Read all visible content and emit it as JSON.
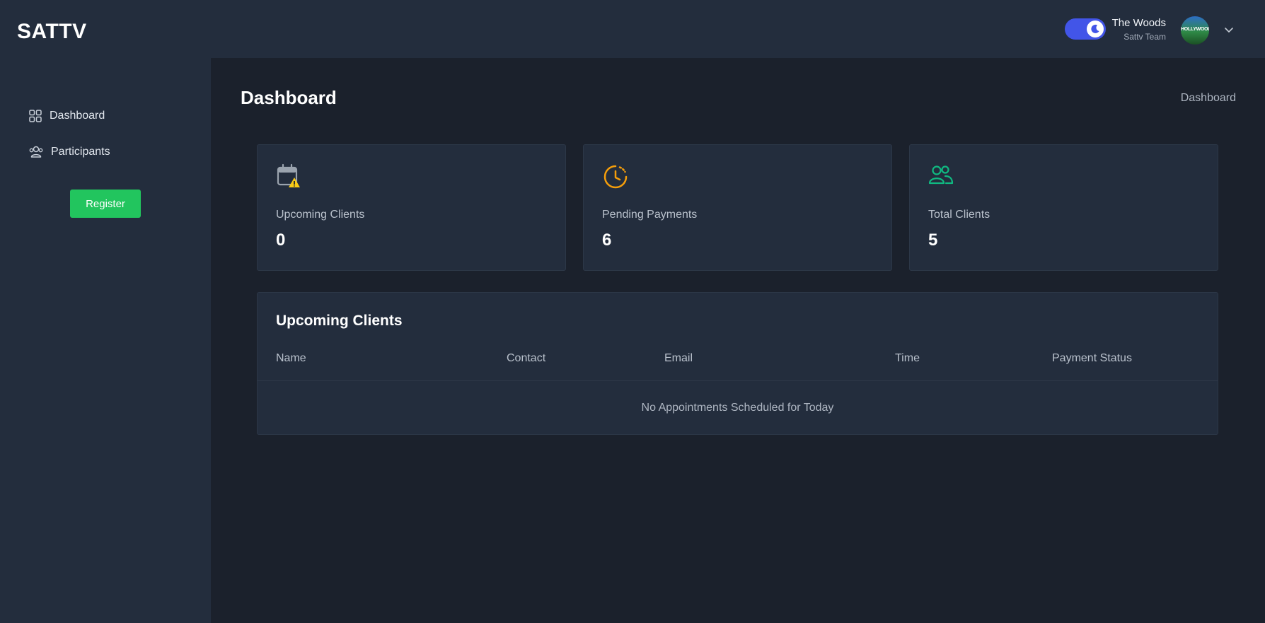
{
  "header": {
    "brand": "SATTV",
    "user": {
      "name": "The Woods",
      "team": "Sattv Team",
      "avatar_text": "HOLLYWOOD"
    },
    "theme_toggle_on": true,
    "accent": "#4255e8"
  },
  "sidebar": {
    "items": [
      {
        "label": "Dashboard",
        "icon": "grid-icon"
      },
      {
        "label": "Participants",
        "icon": "users-icon"
      }
    ],
    "register_label": "Register",
    "register_color": "#22c55e"
  },
  "main": {
    "title": "Dashboard",
    "breadcrumb": "Dashboard",
    "stats": [
      {
        "label": "Upcoming Clients",
        "value": "0",
        "icon": "calendar-warning-icon",
        "color": "#9aa3ae"
      },
      {
        "label": "Pending Payments",
        "value": "6",
        "icon": "clock-refresh-icon",
        "color": "#f59e0b"
      },
      {
        "label": "Total Clients",
        "value": "5",
        "icon": "users-icon",
        "color": "#10b981"
      }
    ],
    "table": {
      "title": "Upcoming Clients",
      "columns": [
        "Name",
        "Contact",
        "Email",
        "Time",
        "Payment Status"
      ],
      "empty_message": "No Appointments Scheduled for Today"
    }
  }
}
